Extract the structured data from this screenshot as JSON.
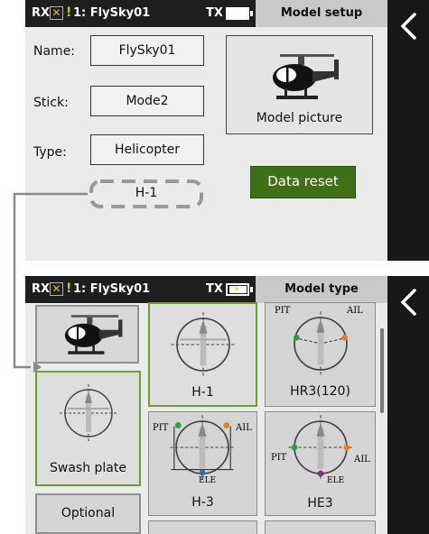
{
  "setup": {
    "status": {
      "rx": "RX",
      "rx_alert": "!",
      "rx_name": "1: FlySky01",
      "tx": "TX",
      "title": "Model setup"
    },
    "name_label": "Name:",
    "name_value": "FlySky01",
    "stick_label": "Stick:",
    "stick_value": "Mode2",
    "type_label": "Type:",
    "type_value": "Helicopter",
    "swash_value": "H-1",
    "picture_label": "Model picture",
    "reset_label": "Data reset",
    "back_icon": "chevron-left-icon"
  },
  "type_screen": {
    "status": {
      "rx": "RX",
      "rx_alert": "!",
      "rx_name": "1: FlySky01",
      "tx": "TX",
      "title": "Model type"
    },
    "swash_label": "Swash plate",
    "optional_label": "Optional",
    "tiles": [
      {
        "label": "H-1"
      },
      {
        "label": "HR3(120)",
        "left": "PIT",
        "right": "AIL"
      },
      {
        "label": "H-3",
        "left": "PIT",
        "right": "AIL",
        "bottom": "ELE"
      },
      {
        "label": "HE3",
        "left": "PIT",
        "right": "AIL",
        "bottom": "ELE"
      }
    ],
    "back_icon": "chevron-left-icon"
  },
  "colors": {
    "accent_green": "#3f6f17",
    "selected_border": "#6ca02e",
    "warn_yellow": "#e0bf00"
  }
}
